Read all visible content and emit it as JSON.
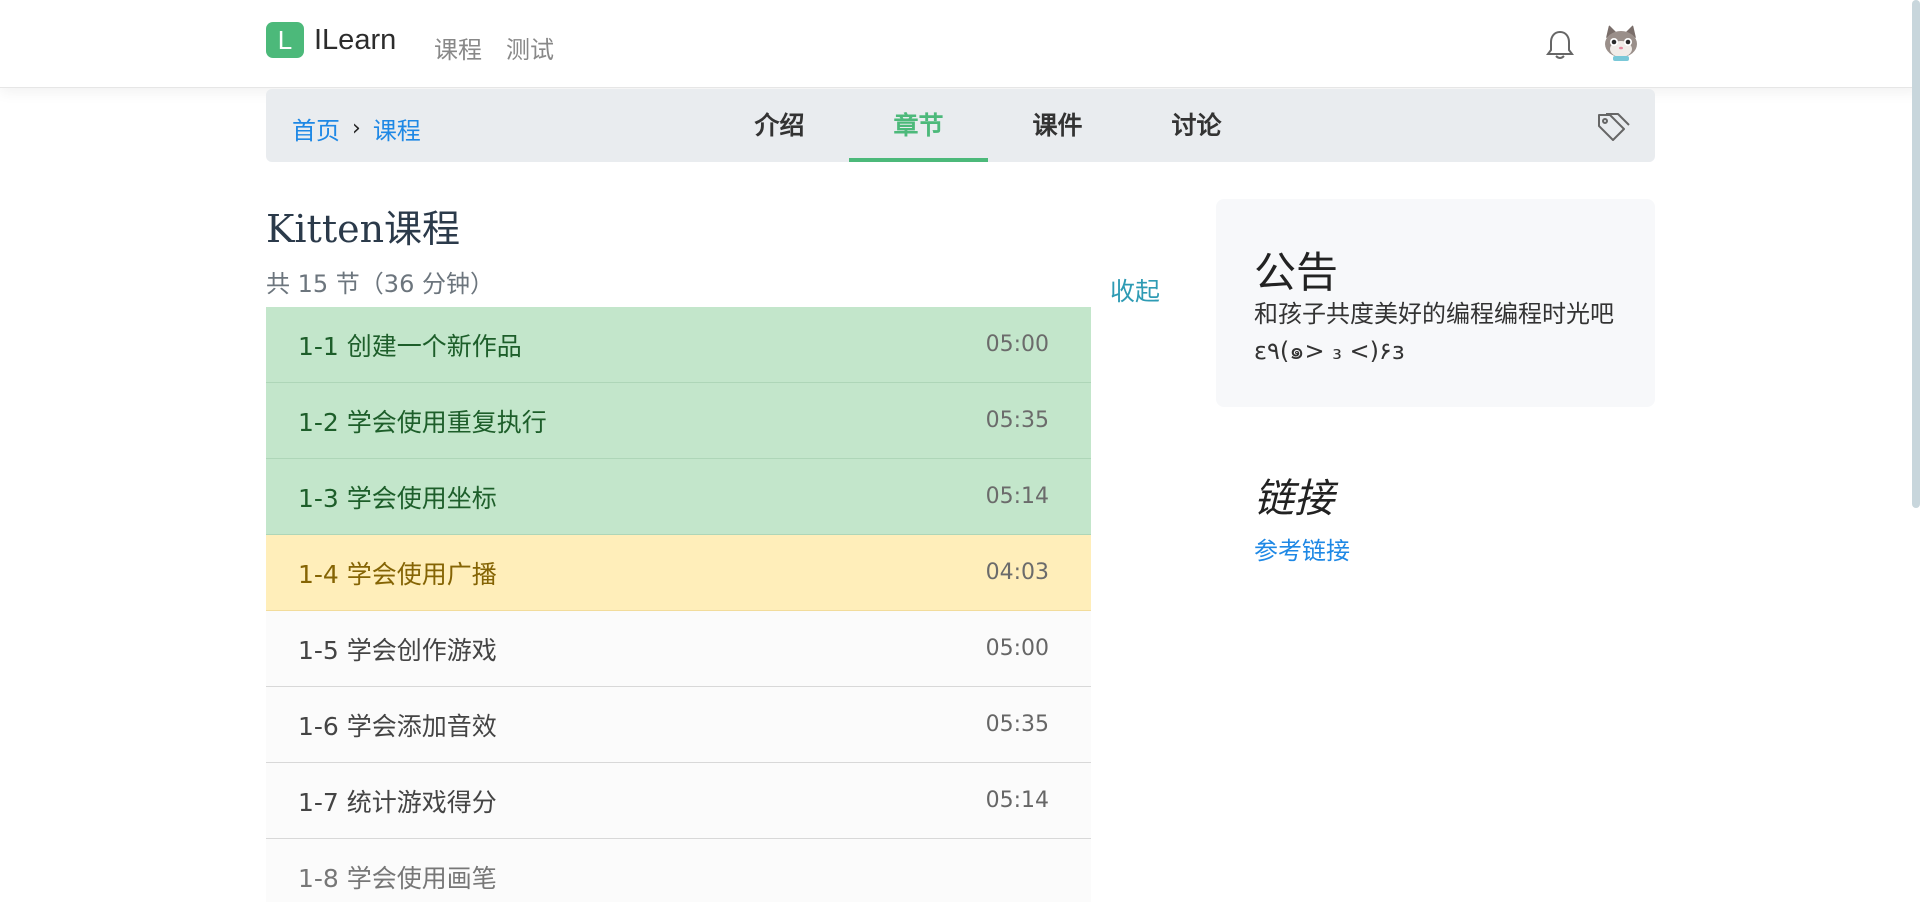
{
  "navbar": {
    "logo_letter": "L",
    "brand": "ILearn",
    "links": [
      "课程",
      "测试"
    ],
    "bell_icon": "bell-icon",
    "avatar_icon": "cat-avatar"
  },
  "tabbar": {
    "breadcrumb": [
      "首页",
      "课程"
    ],
    "breadcrumb_separator": "›",
    "tabs": [
      "介绍",
      "章节",
      "课件",
      "讨论"
    ],
    "active_tab": "章节",
    "tag_icon": "tag-icon"
  },
  "course": {
    "title": "Kitten课程",
    "meta": "共 15 节（36 分钟）",
    "collapse_label": "收起"
  },
  "chapters": [
    {
      "title": "1-1 创建一个新作品",
      "time": "05:00",
      "status": "done"
    },
    {
      "title": "1-2 学会使用重复执行",
      "time": "05:35",
      "status": "done"
    },
    {
      "title": "1-3 学会使用坐标",
      "time": "05:14",
      "status": "done"
    },
    {
      "title": "1-4 学会使用广播",
      "time": "04:03",
      "status": "current"
    },
    {
      "title": "1-5 学会创作游戏",
      "time": "05:00",
      "status": "todo"
    },
    {
      "title": "1-6 学会添加音效",
      "time": "05:35",
      "status": "todo"
    },
    {
      "title": "1-7 统计游戏得分",
      "time": "05:14",
      "status": "todo"
    },
    {
      "title": "1-8 学会使用画笔",
      "time": "",
      "status": "todo"
    }
  ],
  "sidebar": {
    "notice_title": "公告",
    "notice_body": "和孩子共度美好的编程编程时光吧ε٩(๑> ₃ <)۶з",
    "links_title": "链接",
    "ref_link": "参考链接"
  },
  "colors": {
    "brand_green": "#4cb97a",
    "done_bg": "#c3e6cb",
    "current_bg": "#ffeeba",
    "link_blue": "#1e88e5"
  }
}
